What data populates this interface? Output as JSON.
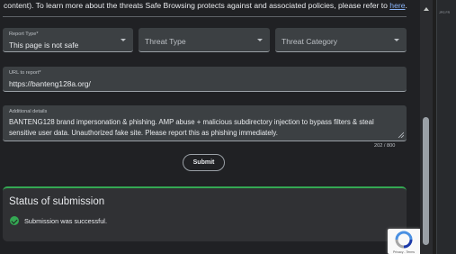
{
  "intro": {
    "text": "content). To learn more about the threats Safe Browsing protects against and associated policies, please refer to ",
    "link": "here",
    "end": "."
  },
  "form": {
    "report_type": {
      "label": "Report Type*",
      "value": "This page is not safe"
    },
    "threat_type": {
      "placeholder": "Threat Type"
    },
    "threat_category": {
      "placeholder": "Threat Category"
    },
    "url": {
      "label": "URL to report*",
      "value": "https://banteng128a.org/"
    },
    "details": {
      "label": "Additional details",
      "value": "BANTENG128 brand impersonation & phishing. AMP abuse + malicious subdirectory injection to bypass filters & steal sensitive user data. Unauthorized fake site. Please report this as phishing immediately.",
      "counter": "202 / 800"
    },
    "submit_label": "Submit"
  },
  "status": {
    "title": "Status of submission",
    "message": "Submission was successful."
  },
  "side": {
    "text": "JPG FR"
  },
  "colors": {
    "success": "#34a853",
    "link": "#8ab4f8",
    "field_bg": "#3c4043",
    "page_bg": "#202124"
  },
  "icons": {
    "select_caret": "caret-down-icon",
    "success": "check-circle-icon",
    "recaptcha": "recaptcha-icon"
  }
}
